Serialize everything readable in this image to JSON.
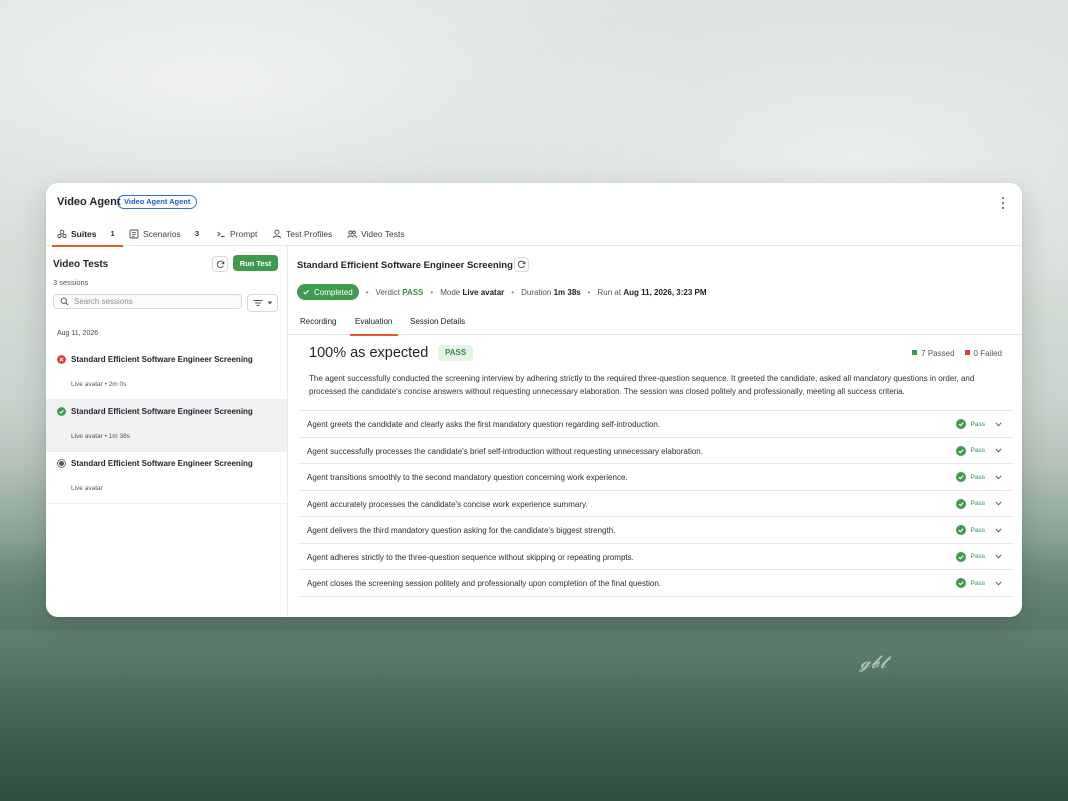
{
  "app": {
    "title": "Video Agent",
    "badge": "Video Agent Agent"
  },
  "tabs": [
    {
      "label": "Suites",
      "count": "1",
      "icon": "suites-icon",
      "active": true
    },
    {
      "label": "Scenarios",
      "count": "3",
      "icon": "document-icon"
    },
    {
      "label": "Prompt",
      "icon": "terminal-icon"
    },
    {
      "label": "Test Profiles",
      "icon": "person-icon"
    },
    {
      "label": "Video Tests",
      "icon": "people-icon"
    }
  ],
  "sidebar": {
    "title": "Video Tests",
    "run_label": "Run Test",
    "sessions_count": "3 sessions",
    "search_placeholder": "Search sessions",
    "date": "Aug 11, 2026",
    "sessions": [
      {
        "title": "Standard Efficient Software Engineer Screening",
        "meta": "Live avatar • 2m 0s",
        "status": "failed",
        "status_color": "#d93a3a"
      },
      {
        "title": "Standard Efficient Software Engineer Screening",
        "meta": "Live avatar • 1m 38s",
        "status": "passed",
        "status_color": "#3f9a4e",
        "selected": true
      },
      {
        "title": "Standard Efficient Software Engineer Screening",
        "meta": "Live avatar",
        "status": "pending",
        "status_color": "#555555"
      }
    ]
  },
  "detail": {
    "title": "Standard Efficient Software Engineer Screening",
    "status": "Completed",
    "verdict_label": "Verdict",
    "verdict": "PASS",
    "mode_label": "Mode",
    "mode": "Live avatar",
    "duration_label": "Duration",
    "duration": "1m 38s",
    "run_label": "Run at",
    "run_at": "Aug 11, 2026, 3:23 PM",
    "subtabs": [
      "Recording",
      "Evaluation",
      "Session Details"
    ],
    "active_subtab": "Evaluation"
  },
  "evaluation": {
    "headline": "100% as expected",
    "badge": "PASS",
    "passed": "7 Passed",
    "failed": "0 Failed",
    "summary": "The agent successfully conducted the screening interview by adhering strictly to the required three-question sequence. It greeted the candidate, asked all mandatory questions in order, and processed the candidate's concise answers without requesting unnecessary elaboration. The session was closed politely and professionally, meeting all success criteria.",
    "criteria": [
      {
        "text": "Agent greets the candidate and clearly asks the first mandatory question regarding self-introduction.",
        "status": "Pass"
      },
      {
        "text": "Agent successfully processes the candidate's brief self-introduction without requesting unnecessary elaboration.",
        "status": "Pass"
      },
      {
        "text": "Agent transitions smoothly to the second mandatory question concerning work experience.",
        "status": "Pass"
      },
      {
        "text": "Agent accurately processes the candidate's concise work experience summary.",
        "status": "Pass"
      },
      {
        "text": "Agent delivers the third mandatory question asking for the candidate's biggest strength.",
        "status": "Pass"
      },
      {
        "text": "Agent adheres strictly to the three-question sequence without skipping or repeating prompts.",
        "status": "Pass"
      },
      {
        "text": "Agent closes the screening session politely and professionally upon completion of the final question.",
        "status": "Pass"
      }
    ]
  },
  "colors": {
    "accent": "#e05a2b",
    "success": "#3f9a4e",
    "danger": "#d93a3a",
    "link": "#2f6fdc"
  }
}
